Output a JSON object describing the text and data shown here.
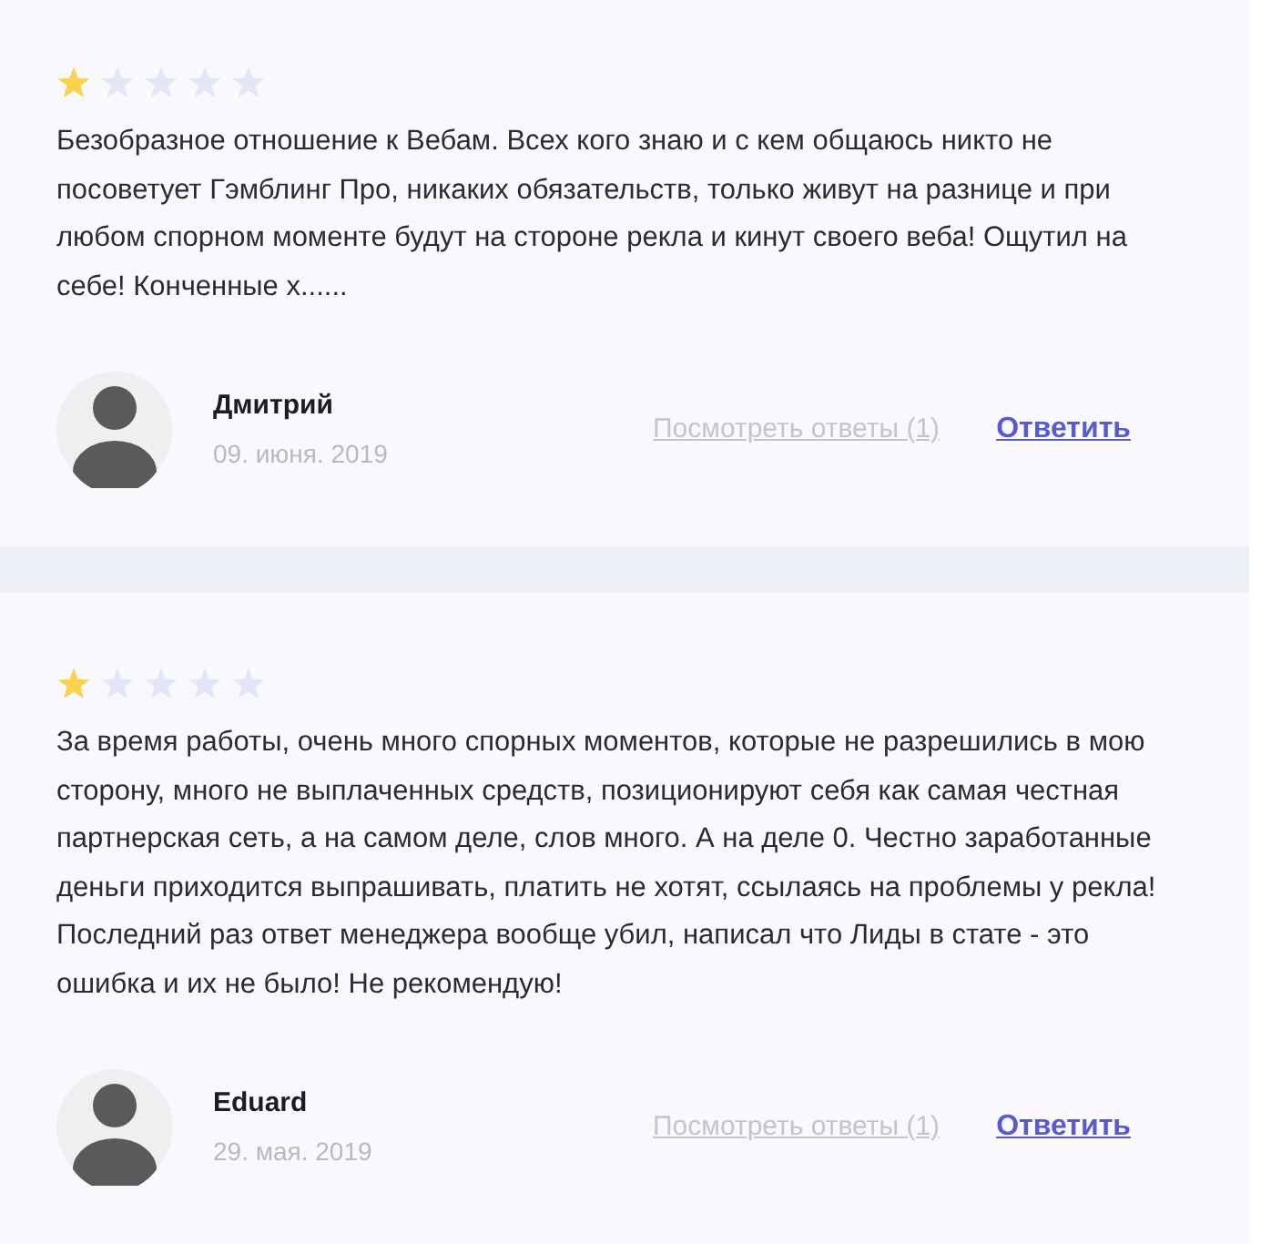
{
  "reviews": [
    {
      "stars": 1,
      "text": "Безобразное отношение к Вебам. Всех кого знаю и с кем общаюсь никто не посоветует Гэмблинг Про, никаких обязательств, только живут на разнице и при любом спорном моменте будут на стороне рекла и кинут своего веба! Ощутил на себе! Конченные х......",
      "author": "Дмитрий",
      "date": "09. июня. 2019",
      "replies_link": "Посмотреть ответы (1)",
      "reply_link": "Ответить"
    },
    {
      "stars": 1,
      "text": "За время работы, очень много спорных моментов, которые не разрешились в мою сторону, много не выплаченных средств, позиционируют себя как самая честная партнерская сеть, а на самом деле, слов много. А на деле 0. Честно заработанные деньги приходится выпрашивать, платить не хотят, ссылаясь на проблемы у рекла! Последний раз ответ менеджера вообще убил, написал что Лиды в стате - это ошибка и их не было! Не рекомендую!",
      "author": "Eduard",
      "date": "29. мая. 2019",
      "replies_link": "Посмотреть ответы (1)",
      "reply_link": "Ответить"
    }
  ]
}
